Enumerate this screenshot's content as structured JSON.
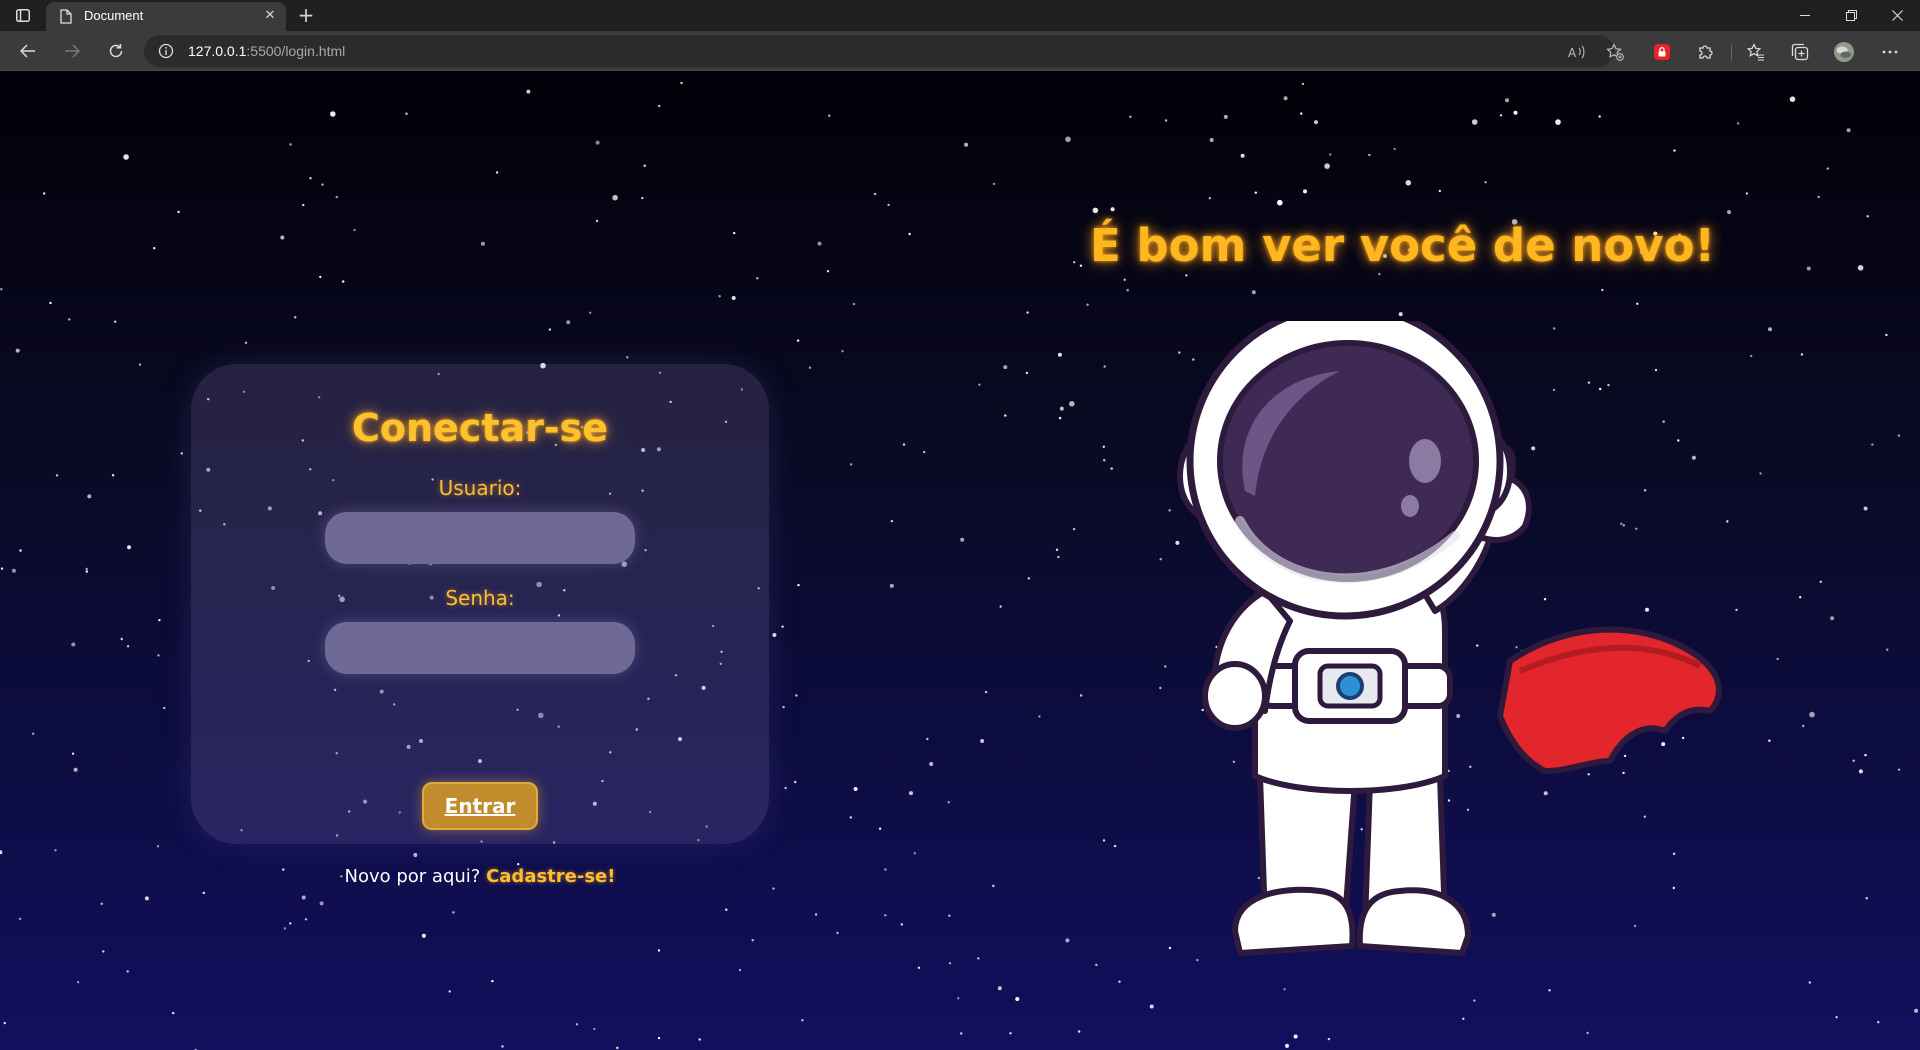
{
  "browser": {
    "tab_title": "Document",
    "url_host": "127.0.0.1",
    "url_path": ":5500/login.html",
    "icons": {
      "tab_actions": "tab-actions-icon",
      "page": "page-icon",
      "close": "close-icon",
      "new_tab": "plus-icon",
      "back": "arrow-left-icon",
      "forward": "arrow-right-icon",
      "reload": "reload-icon",
      "info": "info-icon",
      "read_aloud": "read-aloud-icon",
      "favorite": "star-plus-icon",
      "extension_red": "extension-lock-icon",
      "extensions": "puzzle-icon",
      "favorites": "favorites-icon",
      "collections": "collections-icon",
      "profile": "avatar-icon",
      "menu": "more-icon"
    }
  },
  "login": {
    "title": "Conectar-se",
    "user_label": "Usuario:",
    "user_value": "",
    "password_label": "Senha:",
    "password_value": "",
    "submit_label": "Entrar",
    "signup_prompt": "Novo por aqui?",
    "signup_link": "Cadastre-se!"
  },
  "hero": {
    "title": "É bom ver você de novo!"
  },
  "colors": {
    "accent": "#ffb71f",
    "button": "#c08c2c",
    "cape": "#e3262c",
    "helmet": "#3f2a55"
  }
}
